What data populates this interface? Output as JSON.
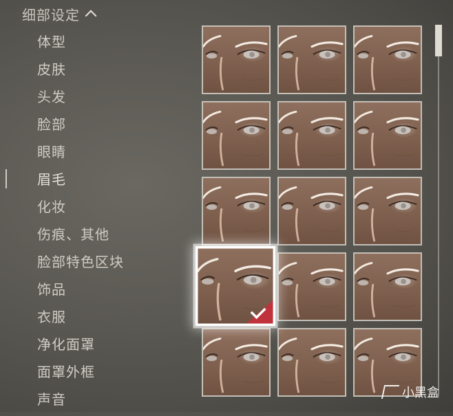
{
  "section": {
    "title": "细部设定"
  },
  "menu": {
    "items": [
      {
        "label": "体型"
      },
      {
        "label": "皮肤"
      },
      {
        "label": "头发"
      },
      {
        "label": "脸部"
      },
      {
        "label": "眼睛"
      },
      {
        "label": "眉毛"
      },
      {
        "label": "化妆"
      },
      {
        "label": "伤痕、其他"
      },
      {
        "label": "脸部特色区块"
      },
      {
        "label": "饰品"
      },
      {
        "label": "衣服"
      },
      {
        "label": "净化面罩"
      },
      {
        "label": "面罩外框"
      },
      {
        "label": "声音"
      }
    ],
    "active_index": 5
  },
  "presets": {
    "columns": 3,
    "visible_count": 15,
    "selected_index": 9
  },
  "scrollbar": {
    "position": 0
  },
  "watermark": {
    "text": "小黑盒"
  },
  "colors": {
    "background": "#5a5852",
    "selection_badge": "#c0333c",
    "tile_border": "#c4c0b8",
    "skin": "#8e6f5d"
  },
  "icons": {
    "collapse": "chevron-up-icon",
    "selected": "check-icon"
  }
}
